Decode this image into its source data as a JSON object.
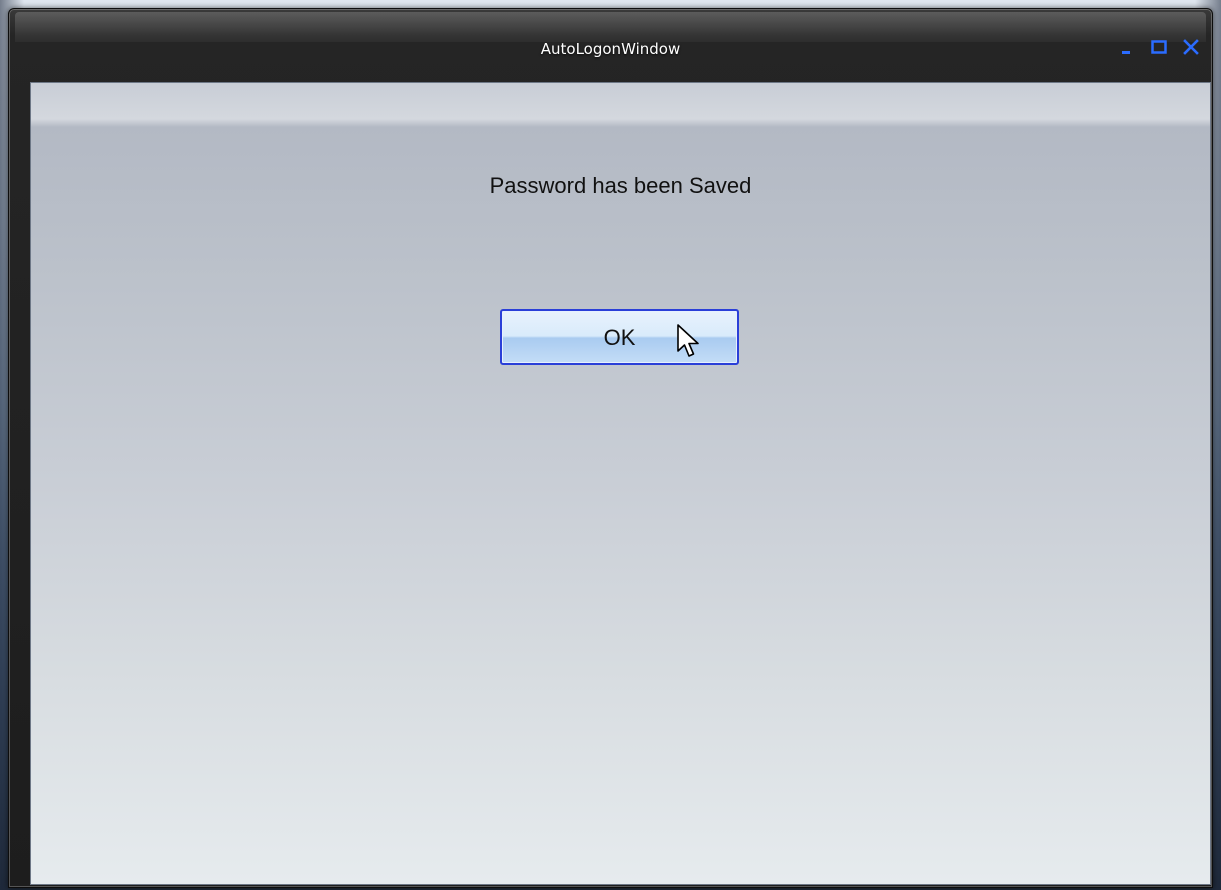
{
  "window": {
    "title": "AutoLogonWindow",
    "controls": {
      "minimize_icon": "minimize-icon",
      "maximize_icon": "maximize-icon",
      "close_icon": "close-icon",
      "color": "#2b6cff"
    }
  },
  "dialog": {
    "message": "Password has been Saved",
    "ok_label": "OK",
    "ok_focused": true
  },
  "pointer": {
    "icon": "mouse-pointer-icon"
  }
}
